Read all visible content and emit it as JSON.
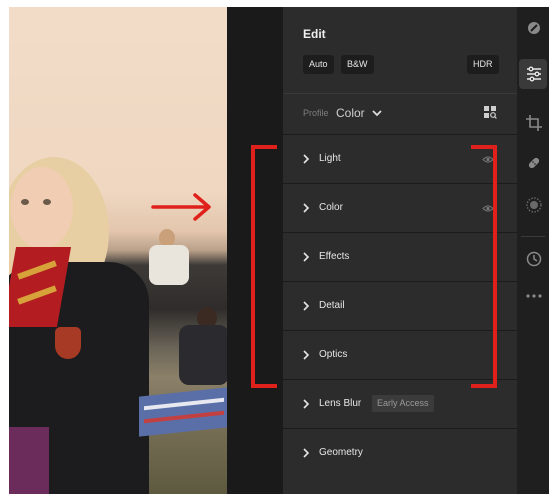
{
  "edit_panel": {
    "title": "Edit",
    "buttons": {
      "auto": "Auto",
      "bw": "B&W",
      "hdr": "HDR"
    },
    "profile": {
      "label": "Profile",
      "value": "Color"
    },
    "sections": [
      {
        "label": "Light",
        "eye_visible": true
      },
      {
        "label": "Color",
        "eye_visible": true
      },
      {
        "label": "Effects"
      },
      {
        "label": "Detail"
      },
      {
        "label": "Optics"
      },
      {
        "label": "Lens Blur",
        "badge": "Early Access"
      },
      {
        "label": "Geometry"
      }
    ]
  },
  "toolbar": {
    "tools": [
      "remove-icon",
      "edit-sliders-icon",
      "crop-icon",
      "heal-icon",
      "mask-icon",
      "history-icon",
      "more-icon"
    ],
    "active_tool": "edit-sliders-icon"
  },
  "annotation": {
    "color": "#e0211b"
  },
  "colors": {
    "panel": "#2c2c2c",
    "toolbar": "#1f1f1f",
    "text": "#e6e6e6"
  }
}
